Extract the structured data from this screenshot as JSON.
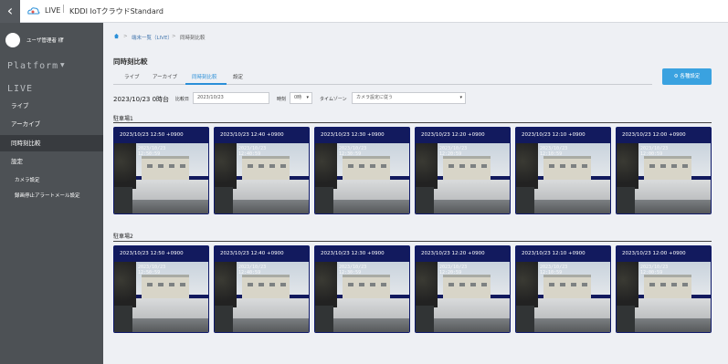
{
  "topbar": {
    "back_icon": "‹",
    "live": "LIVE",
    "separator": "|",
    "brand": "KDDI IoTクラウドStandard"
  },
  "sidebar": {
    "user_name": "ユーザ管理者 様",
    "user_chevron": "⌄",
    "platform": "Platform",
    "platform_caret": "▼",
    "live": "LIVE",
    "items": [
      {
        "label": "ライブ"
      },
      {
        "label": "アーカイブ"
      },
      {
        "label": "同時刻比較"
      },
      {
        "label": "設定"
      }
    ],
    "sub_items": [
      {
        "label": "カメラ設定"
      },
      {
        "label": "録画停止アラートメール設定"
      }
    ]
  },
  "breadcrumb": {
    "item1": "端末一覧（LIVE）",
    "item2": "同時刻比較",
    "chevron": ">"
  },
  "page": {
    "title": "同時刻比較",
    "tabs": [
      "ライブ",
      "アーカイブ",
      "同時刻比較",
      "設定"
    ],
    "active_tab": "同時刻比較",
    "settings_button": "各種設定"
  },
  "filters": {
    "heading": "2023/10/23 0時台",
    "date_label": "比較日",
    "date_value": "2023/10/23",
    "hour_label": "時刻",
    "hour_value": "0時",
    "timezone_label": "タイムゾーン",
    "timezone_value": "カメラ設定に従う",
    "caret": "▾"
  },
  "sections": [
    {
      "title": "駐車場1",
      "cameras": [
        {
          "timestamp": "2023/10/23 12:50 +0900",
          "stamp": "2023/10/23\n12:50:59"
        },
        {
          "timestamp": "2023/10/23 12:40 +0900",
          "stamp": "2023/10/23\n12:40:59"
        },
        {
          "timestamp": "2023/10/23 12:30 +0900",
          "stamp": "2023/10/23\n12:30:59"
        },
        {
          "timestamp": "2023/10/23 12:20 +0900",
          "stamp": "2023/10/23\n12:20:59"
        },
        {
          "timestamp": "2023/10/23 12:10 +0900",
          "stamp": "2023/10/23\n12:10:59"
        },
        {
          "timestamp": "2023/10/23 12:00 +0900",
          "stamp": "2023/10/23\n12:00:59"
        }
      ]
    },
    {
      "title": "駐車場2",
      "cameras": [
        {
          "timestamp": "2023/10/23 12:50 +0900",
          "stamp": "2023/10/23\n12:50:59"
        },
        {
          "timestamp": "2023/10/23 12:40 +0900",
          "stamp": "2023/10/23\n12:40:59"
        },
        {
          "timestamp": "2023/10/23 12:30 +0900",
          "stamp": "2023/10/23\n12:30:59"
        },
        {
          "timestamp": "2023/10/23 12:20 +0900",
          "stamp": "2023/10/23\n12:20:59"
        },
        {
          "timestamp": "2023/10/23 12:10 +0900",
          "stamp": "2023/10/23\n12:10:59"
        },
        {
          "timestamp": "2023/10/23 12:00 +0900",
          "stamp": "2023/10/23\n12:00:59"
        }
      ]
    }
  ],
  "colors": {
    "accent": "#3aa2e0",
    "sidebar": "#4d5155",
    "camera_header": "#121a5e"
  }
}
